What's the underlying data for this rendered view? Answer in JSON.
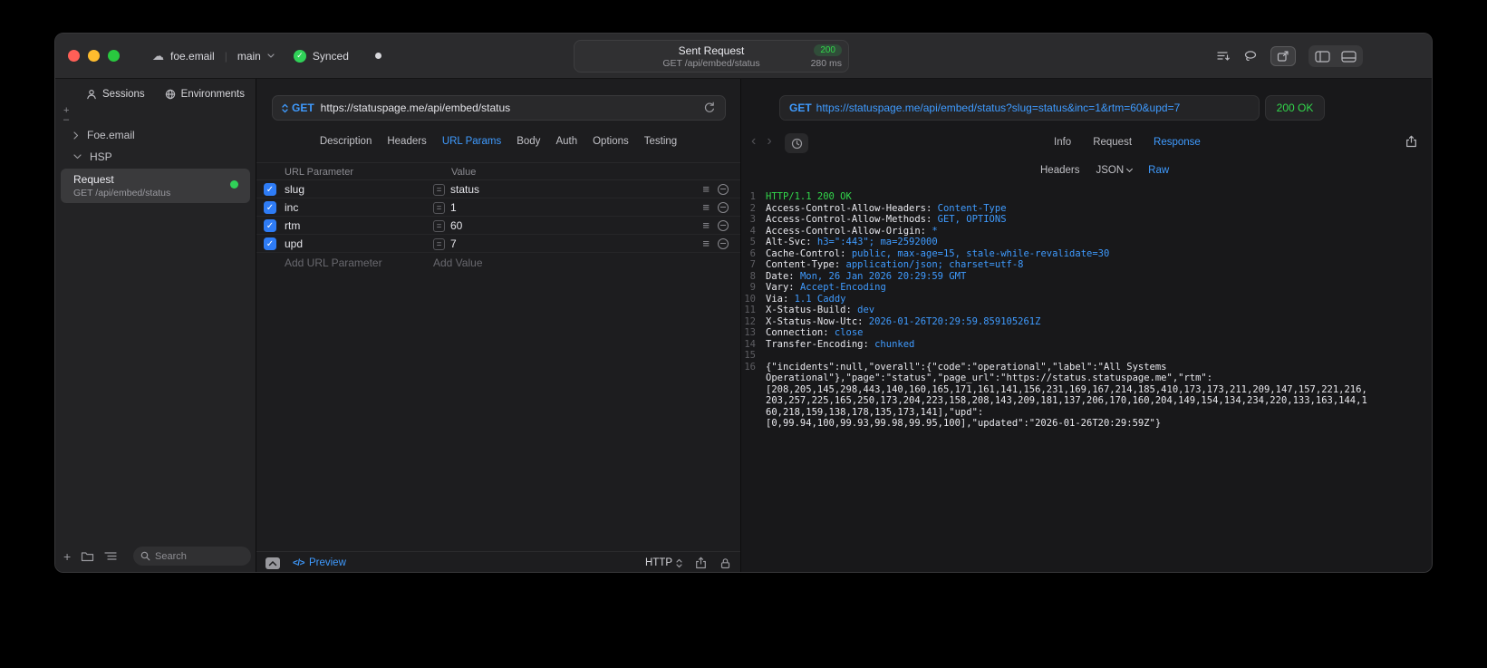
{
  "icons": {
    "checkmark": "✓",
    "menu_lines": "≡",
    "cloud": "☁",
    "code": "</>",
    "back": "‹",
    "forward": "›",
    "plus": "+",
    "minus": "–",
    "equals": "="
  },
  "colors": {
    "accent_blue": "#3F9BFF",
    "success_green": "#32D74B",
    "checkbox_blue": "#2E7CF6",
    "badge_green": "#30D158"
  },
  "titlebar": {
    "project": "foe.email",
    "branch": "main",
    "sync_label": "Synced",
    "request_summary": {
      "title": "Sent Request",
      "status_code": "200",
      "method_path": "GET /api/embed/status",
      "duration": "280 ms"
    }
  },
  "sidebar": {
    "tabs": [
      {
        "label": "Sessions"
      },
      {
        "label": "Environments"
      }
    ],
    "tree": [
      {
        "label": "Foe.email",
        "expanded": false
      },
      {
        "label": "HSP",
        "expanded": true
      }
    ],
    "request_item": {
      "title": "Request",
      "subtitle": "GET /api/embed/status"
    },
    "search_placeholder": "Search"
  },
  "request_editor": {
    "method": "GET",
    "url": "https://statuspage.me/api/embed/status",
    "tabs": [
      "Description",
      "Headers",
      "URL Params",
      "Body",
      "Auth",
      "Options",
      "Testing"
    ],
    "active_tab": "URL Params",
    "params": {
      "columns": [
        "URL Parameter",
        "Value"
      ],
      "rows": [
        {
          "checked": true,
          "name": "slug",
          "value": "status"
        },
        {
          "checked": true,
          "name": "inc",
          "value": "1"
        },
        {
          "checked": true,
          "name": "rtm",
          "value": "60"
        },
        {
          "checked": true,
          "name": "upd",
          "value": "7"
        }
      ],
      "add_name_placeholder": "Add URL Parameter",
      "add_value_placeholder": "Add Value"
    },
    "footer": {
      "preview": "Preview",
      "protocol": "HTTP"
    }
  },
  "response_viewer": {
    "method": "GET",
    "url_with_query": "https://statuspage.me/api/embed/status?slug=status&inc=1&rtm=60&upd=7",
    "status": "200 OK",
    "tabs": [
      "Info",
      "Request",
      "Response"
    ],
    "active_tab": "Response",
    "subtabs": [
      "Headers",
      "JSON",
      "Raw"
    ],
    "active_subtab": "Raw",
    "body_lines": [
      {
        "num": 1,
        "segments": [
          {
            "t": "HTTP/1.1 200 OK",
            "c": "green"
          }
        ]
      },
      {
        "num": 2,
        "segments": [
          {
            "t": "Access-Control-Allow-Headers: ",
            "c": "plain"
          },
          {
            "t": "Content-Type",
            "c": "blue"
          }
        ]
      },
      {
        "num": 3,
        "segments": [
          {
            "t": "Access-Control-Allow-Methods: ",
            "c": "plain"
          },
          {
            "t": "GET, OPTIONS",
            "c": "blue"
          }
        ]
      },
      {
        "num": 4,
        "segments": [
          {
            "t": "Access-Control-Allow-Origin: ",
            "c": "plain"
          },
          {
            "t": "*",
            "c": "blue"
          }
        ]
      },
      {
        "num": 5,
        "segments": [
          {
            "t": "Alt-Svc: ",
            "c": "plain"
          },
          {
            "t": "h3=\":443\"; ma=2592000",
            "c": "blue"
          }
        ]
      },
      {
        "num": 6,
        "segments": [
          {
            "t": "Cache-Control: ",
            "c": "plain"
          },
          {
            "t": "public, max-age=15, stale-while-revalidate=30",
            "c": "blue"
          }
        ]
      },
      {
        "num": 7,
        "segments": [
          {
            "t": "Content-Type: ",
            "c": "plain"
          },
          {
            "t": "application/json; charset=utf-8",
            "c": "blue"
          }
        ]
      },
      {
        "num": 8,
        "segments": [
          {
            "t": "Date: ",
            "c": "plain"
          },
          {
            "t": "Mon, 26 Jan 2026 20:29:59 GMT",
            "c": "blue"
          }
        ]
      },
      {
        "num": 9,
        "segments": [
          {
            "t": "Vary: ",
            "c": "plain"
          },
          {
            "t": "Accept-Encoding",
            "c": "blue"
          }
        ]
      },
      {
        "num": 10,
        "segments": [
          {
            "t": "Via: ",
            "c": "plain"
          },
          {
            "t": "1.1 Caddy",
            "c": "blue"
          }
        ]
      },
      {
        "num": 11,
        "segments": [
          {
            "t": "X-Status-Build: ",
            "c": "plain"
          },
          {
            "t": "dev",
            "c": "blue"
          }
        ]
      },
      {
        "num": 12,
        "segments": [
          {
            "t": "X-Status-Now-Utc: ",
            "c": "plain"
          },
          {
            "t": "2026-01-26T20:29:59.859105261Z",
            "c": "blue"
          }
        ]
      },
      {
        "num": 13,
        "segments": [
          {
            "t": "Connection: ",
            "c": "plain"
          },
          {
            "t": "close",
            "c": "blue"
          }
        ]
      },
      {
        "num": 14,
        "segments": [
          {
            "t": "Transfer-Encoding: ",
            "c": "plain"
          },
          {
            "t": "chunked",
            "c": "blue"
          }
        ]
      },
      {
        "num": 15,
        "segments": []
      },
      {
        "num": 16,
        "segments": [
          {
            "t": "{\"incidents\":null,\"overall\":{\"code\":\"operational\",\"label\":\"All Systems\nOperational\"},\"page\":\"status\",\"page_url\":\"https://status.statuspage.me\",\"rtm\":\n[208,205,145,298,443,140,160,165,171,161,141,156,231,169,167,214,185,410,173,173,211,209,147,157,221,216,\n203,257,225,165,250,173,204,223,158,208,143,209,181,137,206,170,160,204,149,154,134,234,220,133,163,144,1\n60,218,159,138,178,135,173,141],\"upd\":\n[0,99.94,100,99.93,99.98,99.95,100],\"updated\":\"2026-01-26T20:29:59Z\"}",
            "c": "plain"
          }
        ]
      }
    ]
  }
}
